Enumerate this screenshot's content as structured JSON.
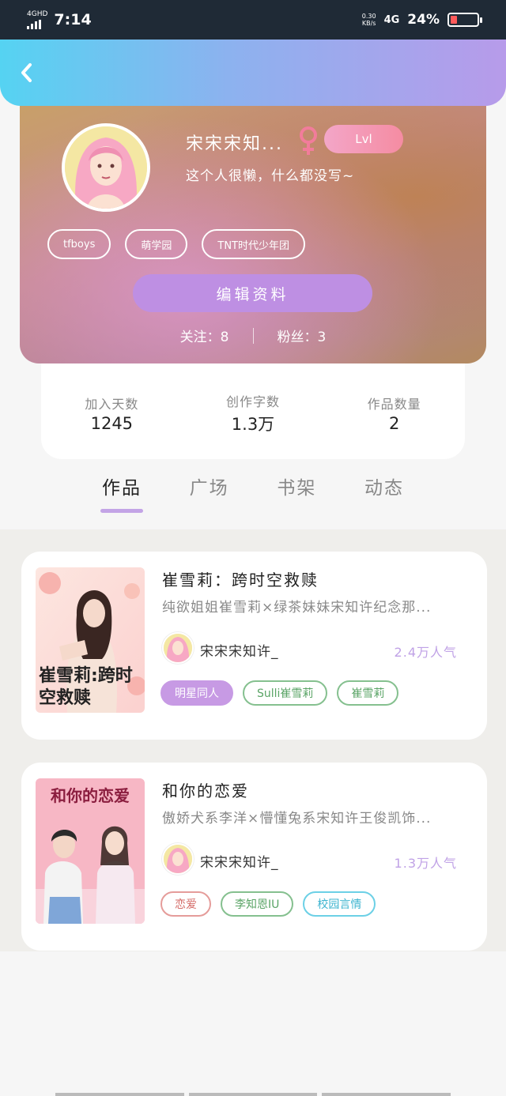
{
  "status_bar": {
    "network": "4GHD",
    "time": "7:14",
    "speed_top": "0.30",
    "speed_unit": "KB/s",
    "signal": "4G",
    "battery": "24%"
  },
  "header": {
    "back_icon": "chevron-left-icon"
  },
  "profile": {
    "name": "宋宋宋知...",
    "gender_icon": "female-icon",
    "level": "Lvl",
    "bio": "这个人很懒，什么都没写~",
    "tags": [
      "tfboys",
      "萌学园",
      "TNT时代少年团"
    ],
    "edit_button": "编辑资料",
    "following": "关注：8",
    "followers": "粉丝：3"
  },
  "stats": [
    {
      "label": "加入天数",
      "value": "1245"
    },
    {
      "label": "创作字数",
      "value": "1.3万"
    },
    {
      "label": "作品数量",
      "value": "2"
    }
  ],
  "tabs": [
    "作品",
    "广场",
    "书架",
    "动态"
  ],
  "works": [
    {
      "title": "崔雪莉：跨时空救赎",
      "desc": "纯欲姐姐崔雪莉×绿茶妹妹宋知许纪念那...",
      "author": "宋宋宋知许_",
      "popularity": "2.4万人气",
      "cover_text": "崔雪莉:跨时空救赎",
      "tags": [
        "明星同人",
        "Sulli崔雪莉",
        "崔雪莉"
      ]
    },
    {
      "title": "和你的恋爱",
      "desc": "傲娇犬系李洋×懵懂兔系宋知许王俊凯饰...",
      "author": "宋宋宋知许_",
      "popularity": "1.3万人气",
      "cover_text": "和你的恋爱",
      "tags": [
        "恋爱",
        "李知恩IU",
        "校园言情"
      ]
    }
  ]
}
